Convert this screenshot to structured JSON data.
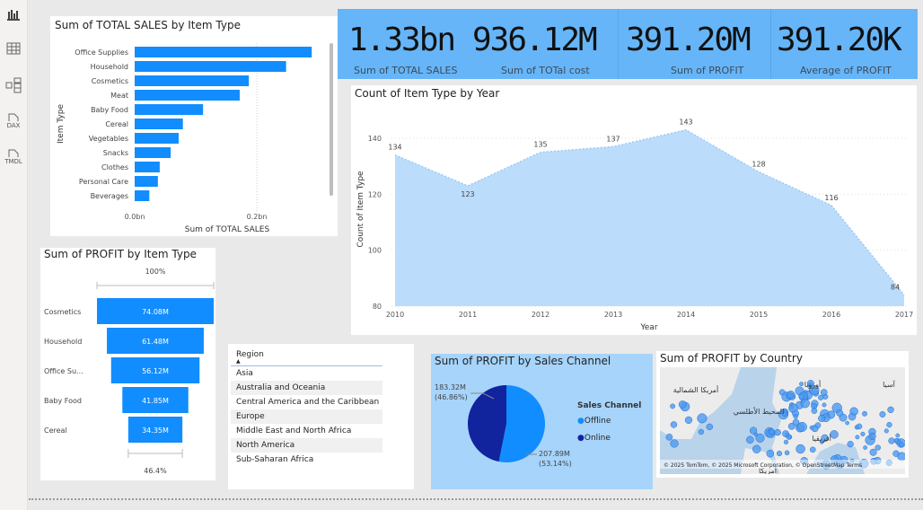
{
  "toolbar": {
    "items": [
      {
        "name": "report-view"
      },
      {
        "name": "table-view"
      },
      {
        "name": "model-view"
      },
      {
        "name": "dax-query-view",
        "label": "DAX"
      },
      {
        "name": "tmdl-view",
        "label": "TMDL"
      }
    ]
  },
  "kpis": [
    {
      "value": "1.33bn",
      "label": "Sum of TOTAL SALES"
    },
    {
      "value": "936.12M",
      "label": "Sum of TOTal cost"
    },
    {
      "value": "391.20M",
      "label": "Sum of PROFIT"
    },
    {
      "value": "391.20K",
      "label": "Average of PROFIT"
    }
  ],
  "region_slicer": {
    "header": "Region",
    "items": [
      "Asia",
      "Australia and Oceania",
      "Central America and the Caribbean",
      "Europe",
      "Middle East and North Africa",
      "North America",
      "Sub-Saharan Africa"
    ]
  },
  "map": {
    "title": "Sum of PROFIT by Country",
    "labels": [
      "أمريكا الشمالية",
      "المحيط الأطلسي",
      "أوروبا",
      "آسيا",
      "أفريقيا",
      "أمريكا"
    ],
    "attribution": "© 2025 TomTom, © 2025 Microsoft Corporation, © OpenStreetMap Terms"
  },
  "chart_data": [
    {
      "type": "bar",
      "title": "Sum of TOTAL SALES by Item Type",
      "xlabel": "Sum of TOTAL SALES",
      "ylabel": "Item Type",
      "xticks": [
        "0.0bn",
        "0.2bn"
      ],
      "xlim": [
        0,
        0.3
      ],
      "categories": [
        "Office Supplies",
        "Household",
        "Cosmetics",
        "Meat",
        "Baby Food",
        "Cereal",
        "Vegetables",
        "Snacks",
        "Clothes",
        "Personal Care",
        "Beverages"
      ],
      "values": [
        0.29,
        0.248,
        0.187,
        0.172,
        0.112,
        0.079,
        0.072,
        0.059,
        0.041,
        0.038,
        0.024
      ],
      "color": "#118dff"
    },
    {
      "type": "area",
      "title": "Count of Item Type by Year",
      "xlabel": "Year",
      "ylabel": "Count of Item Type",
      "ylim": [
        80,
        145
      ],
      "yticks": [
        80,
        100,
        120,
        140
      ],
      "x": [
        2010,
        2011,
        2012,
        2013,
        2014,
        2015,
        2016,
        2017
      ],
      "values": [
        134,
        123,
        135,
        137,
        143,
        128,
        116,
        84
      ],
      "color": "#bcdcfb"
    },
    {
      "type": "funnel",
      "title": "Sum of PROFIT by Item Type",
      "top_label": "100%",
      "bottom_label": "46.4%",
      "categories": [
        "Cosmetics",
        "Household",
        "Office Su...",
        "Baby Food",
        "Cereal"
      ],
      "values": [
        74.08,
        61.48,
        56.12,
        41.85,
        34.35
      ],
      "value_labels": [
        "74.08M",
        "61.48M",
        "56.12M",
        "41.85M",
        "34.35M"
      ],
      "color": "#118dff"
    },
    {
      "type": "pie",
      "title": "Sum of PROFIT by Sales Channel",
      "legend_title": "Sales Channel",
      "legend": "right",
      "categories": [
        "Offline",
        "Online"
      ],
      "values": [
        207.89,
        183.32
      ],
      "labels": [
        "207.89M",
        "183.32M"
      ],
      "percents": [
        "(53.14%)",
        "(46.86%)"
      ],
      "colors": [
        "#118dff",
        "#12239e"
      ]
    }
  ]
}
